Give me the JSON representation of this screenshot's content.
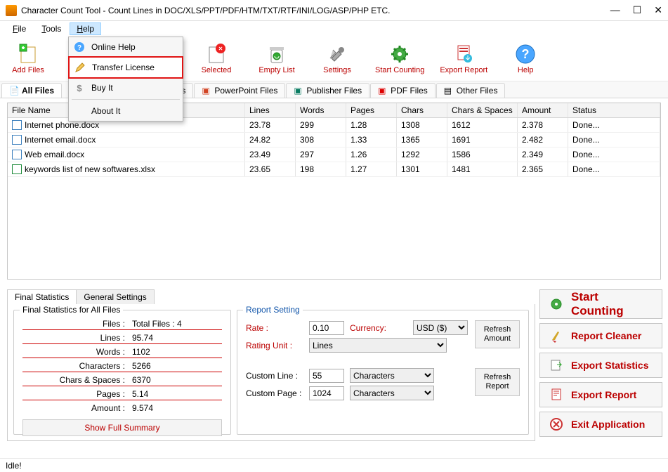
{
  "window": {
    "title": "Character Count Tool - Count Lines in DOC/XLS/PPT/PDF/HTM/TXT/RTF/INI/LOG/ASP/PHP ETC."
  },
  "menubar": {
    "file": "File",
    "tools": "Tools",
    "help": "Help"
  },
  "help_menu": {
    "online_help": "Online Help",
    "transfer_license": "Transfer License",
    "buy_it": "Buy It",
    "about": "About It"
  },
  "toolbar": {
    "add_files": "Add Files",
    "selected": "Selected",
    "empty_list": "Empty List",
    "settings": "Settings",
    "start_counting": "Start Counting",
    "export_report": "Export Report",
    "help": "Help"
  },
  "tabs": {
    "all_files": "All Files",
    "files_partial": "Files",
    "powerpoint": "PowerPoint Files",
    "publisher": "Publisher Files",
    "pdf": "PDF Files",
    "other": "Other Files"
  },
  "grid": {
    "headers": {
      "file_name": "File Name",
      "lines": "Lines",
      "words": "Words",
      "pages": "Pages",
      "chars": "Chars",
      "chars_spaces": "Chars & Spaces",
      "amount": "Amount",
      "status": "Status"
    },
    "rows": [
      {
        "name": "Internet phone.docx",
        "lines": "23.78",
        "words": "299",
        "pages": "1.28",
        "chars": "1308",
        "cs": "1612",
        "amount": "2.378",
        "status": "Done...",
        "type": "word"
      },
      {
        "name": "Internet email.docx",
        "lines": "24.82",
        "words": "308",
        "pages": "1.33",
        "chars": "1365",
        "cs": "1691",
        "amount": "2.482",
        "status": "Done...",
        "type": "word"
      },
      {
        "name": "Web email.docx",
        "lines": "23.49",
        "words": "297",
        "pages": "1.26",
        "chars": "1292",
        "cs": "1586",
        "amount": "2.349",
        "status": "Done...",
        "type": "word"
      },
      {
        "name": "keywords list of new softwares.xlsx",
        "lines": "23.65",
        "words": "198",
        "pages": "1.27",
        "chars": "1301",
        "cs": "1481",
        "amount": "2.365",
        "status": "Done...",
        "type": "excel"
      }
    ]
  },
  "lower_tabs": {
    "final_stats": "Final Statistics",
    "general_settings": "General Settings"
  },
  "final_stats_box": {
    "legend": "Final Statistics for All Files",
    "files_label": "Files :",
    "files_value": "Total Files : 4",
    "lines_label": "Lines :",
    "lines_value": "95.74",
    "words_label": "Words :",
    "words_value": "1102",
    "chars_label": "Characters :",
    "chars_value": "5266",
    "cs_label": "Chars & Spaces :",
    "cs_value": "6370",
    "pages_label": "Pages :",
    "pages_value": "5.14",
    "amount_label": "Amount :",
    "amount_value": "9.574",
    "show_summary": "Show Full Summary"
  },
  "report_setting": {
    "legend": "Report Setting",
    "rate_label": "Rate :",
    "rate_value": "0.10",
    "currency_label": "Currency:",
    "currency_value": "USD ($)",
    "rating_unit_label": "Rating Unit :",
    "rating_unit_value": "Lines",
    "custom_line_label": "Custom Line :",
    "custom_line_value": "55",
    "custom_line_unit": "Characters",
    "custom_page_label": "Custom Page :",
    "custom_page_value": "1024",
    "custom_page_unit": "Characters",
    "refresh_amount": "Refresh Amount",
    "refresh_report": "Refresh Report"
  },
  "right_buttons": {
    "start_counting": "Start Counting",
    "report_cleaner": "Report Cleaner",
    "export_statistics": "Export Statistics",
    "export_report": "Export Report",
    "exit": "Exit Application"
  },
  "status_bar": "Idle!"
}
